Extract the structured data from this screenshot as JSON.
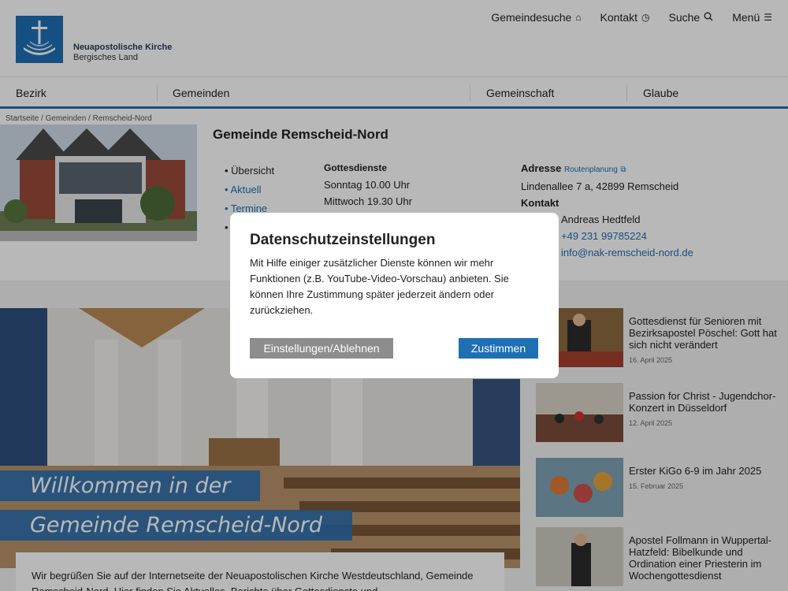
{
  "header": {
    "logo_name": "Neuapostolische Kirche",
    "logo_region": "Bergisches Land",
    "topnav": [
      {
        "label": "Gemeindesuche",
        "icon": "house-icon"
      },
      {
        "label": "Kontakt",
        "icon": "clock-icon"
      },
      {
        "label": "Suche",
        "icon": "search-icon"
      },
      {
        "label": "Menü",
        "icon": "menu-icon"
      }
    ]
  },
  "mainnav": [
    "Bezirk",
    "Gemeinden",
    "Gemeinschaft",
    "Glaube"
  ],
  "breadcrumb": "Startseite / Gemeinden / Remscheid-Nord",
  "gemeinde": {
    "title": "Gemeinde Remscheid-Nord",
    "subnav": [
      "• Übersicht",
      "• Aktuell",
      "• Termine",
      "•"
    ],
    "gottesdienste": {
      "heading": "Gottesdienste",
      "times": [
        "Sonntag 10.00 Uhr",
        "Mittwoch 19.30 Uhr"
      ]
    },
    "adresse": {
      "heading": "Adresse",
      "route": "Routenplanung",
      "street": "Lindenallee 7 a, 42899 Remscheid",
      "kontakt_heading": "Kontakt",
      "person": "Andreas Hedtfeld",
      "phone": "+49 231 99785224",
      "email": "info@nak-remscheid-nord.de"
    }
  },
  "hero": {
    "line1": "Willkommen in der",
    "line2": "Gemeinde Remscheid-Nord"
  },
  "welcome_text": "Wir begrüßen Sie auf der Internetseite der Neuapostolischen Kirche Westdeutschland, Gemeinde Remscheid-Nord. Hier finden Sie Aktuelles, Berichte über Gottesdienste und",
  "news": [
    {
      "title": "Gottesdienst für Senioren mit Bezirksapostel Pöschel: Gott hat sich nicht verändert",
      "date": "16. April 2025"
    },
    {
      "title": "Passion for Christ - Jugendchor-Konzert in Düsseldorf",
      "date": "12. April 2025"
    },
    {
      "title": "Erster KiGo 6-9 im Jahr 2025",
      "date": "15. Februar 2025"
    },
    {
      "title": "Apostel Follmann in Wuppertal-Hatzfeld: Bibelkunde und Ordination einer Priesterin im Wochengottesdienst",
      "date": ""
    }
  ],
  "cookie_modal": {
    "title": "Datenschutzeinstellungen",
    "text": "Mit Hilfe einiger zusätzlicher Dienste können wir mehr Funktionen (z.B. YouTube-Video-Vorschau) anbieten. Sie können Ihre Zustimmung später jederzeit ändern oder zurückziehen.",
    "settings_label": "Einstellungen/Ablehnen",
    "agree_label": "Zustimmen"
  },
  "colors": {
    "brand": "#1f6fb5",
    "overlay": "rgba(0,0,0,0.28)",
    "button_gray": "#8d8d8d"
  }
}
